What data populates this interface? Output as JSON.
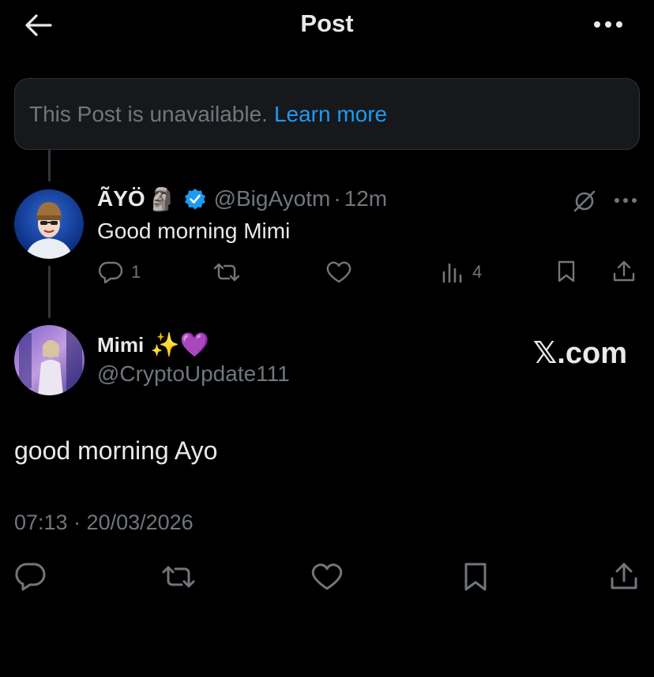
{
  "header": {
    "title": "Post"
  },
  "unavailable_notice": {
    "text": "This Post is unavailable.",
    "link": "Learn more"
  },
  "reply": {
    "display_name": "ÃYÖ",
    "name_emoji": "🗿",
    "verified": true,
    "handle": "@BigAyotm",
    "separator": "·",
    "time": "12m",
    "text": "Good morning Mimi",
    "reply_count": "1",
    "views_count": "4"
  },
  "post": {
    "display_name": "Mimi",
    "name_emojis": "✨💜",
    "handle": "@CryptoUpdate111",
    "watermark": "𝕏.com",
    "text": "good morning Ayo",
    "timestamp": "07:13 · 20/03/2026"
  },
  "icons": {
    "back": "arrow-left-icon",
    "more": "more-dots-icon",
    "grok": "grok-icon",
    "reply": "reply-icon",
    "repost": "repost-icon",
    "like": "heart-icon",
    "views": "views-icon",
    "bookmark": "bookmark-icon",
    "share": "share-icon",
    "verified": "verified-badge-icon"
  },
  "colors": {
    "background": "#000000",
    "accent": "#1d9bf0",
    "muted": "#71767b",
    "text": "#e7e9ea"
  }
}
